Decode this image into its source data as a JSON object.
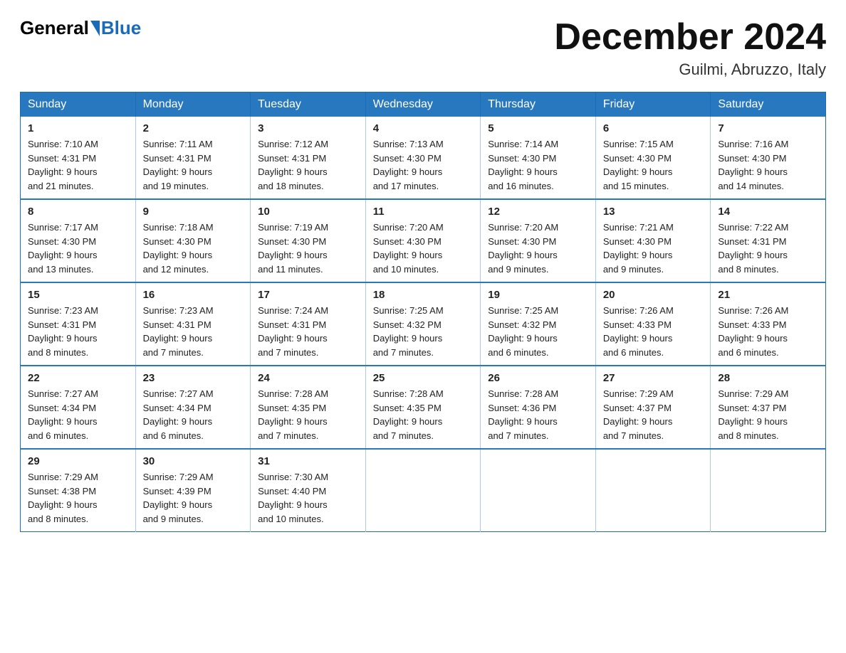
{
  "logo": {
    "general": "General",
    "blue": "Blue"
  },
  "title": "December 2024",
  "subtitle": "Guilmi, Abruzzo, Italy",
  "header_days": [
    "Sunday",
    "Monday",
    "Tuesday",
    "Wednesday",
    "Thursday",
    "Friday",
    "Saturday"
  ],
  "weeks": [
    [
      {
        "day": "1",
        "sunrise": "7:10 AM",
        "sunset": "4:31 PM",
        "daylight": "9 hours and 21 minutes."
      },
      {
        "day": "2",
        "sunrise": "7:11 AM",
        "sunset": "4:31 PM",
        "daylight": "9 hours and 19 minutes."
      },
      {
        "day": "3",
        "sunrise": "7:12 AM",
        "sunset": "4:31 PM",
        "daylight": "9 hours and 18 minutes."
      },
      {
        "day": "4",
        "sunrise": "7:13 AM",
        "sunset": "4:30 PM",
        "daylight": "9 hours and 17 minutes."
      },
      {
        "day": "5",
        "sunrise": "7:14 AM",
        "sunset": "4:30 PM",
        "daylight": "9 hours and 16 minutes."
      },
      {
        "day": "6",
        "sunrise": "7:15 AM",
        "sunset": "4:30 PM",
        "daylight": "9 hours and 15 minutes."
      },
      {
        "day": "7",
        "sunrise": "7:16 AM",
        "sunset": "4:30 PM",
        "daylight": "9 hours and 14 minutes."
      }
    ],
    [
      {
        "day": "8",
        "sunrise": "7:17 AM",
        "sunset": "4:30 PM",
        "daylight": "9 hours and 13 minutes."
      },
      {
        "day": "9",
        "sunrise": "7:18 AM",
        "sunset": "4:30 PM",
        "daylight": "9 hours and 12 minutes."
      },
      {
        "day": "10",
        "sunrise": "7:19 AM",
        "sunset": "4:30 PM",
        "daylight": "9 hours and 11 minutes."
      },
      {
        "day": "11",
        "sunrise": "7:20 AM",
        "sunset": "4:30 PM",
        "daylight": "9 hours and 10 minutes."
      },
      {
        "day": "12",
        "sunrise": "7:20 AM",
        "sunset": "4:30 PM",
        "daylight": "9 hours and 9 minutes."
      },
      {
        "day": "13",
        "sunrise": "7:21 AM",
        "sunset": "4:30 PM",
        "daylight": "9 hours and 9 minutes."
      },
      {
        "day": "14",
        "sunrise": "7:22 AM",
        "sunset": "4:31 PM",
        "daylight": "9 hours and 8 minutes."
      }
    ],
    [
      {
        "day": "15",
        "sunrise": "7:23 AM",
        "sunset": "4:31 PM",
        "daylight": "9 hours and 8 minutes."
      },
      {
        "day": "16",
        "sunrise": "7:23 AM",
        "sunset": "4:31 PM",
        "daylight": "9 hours and 7 minutes."
      },
      {
        "day": "17",
        "sunrise": "7:24 AM",
        "sunset": "4:31 PM",
        "daylight": "9 hours and 7 minutes."
      },
      {
        "day": "18",
        "sunrise": "7:25 AM",
        "sunset": "4:32 PM",
        "daylight": "9 hours and 7 minutes."
      },
      {
        "day": "19",
        "sunrise": "7:25 AM",
        "sunset": "4:32 PM",
        "daylight": "9 hours and 6 minutes."
      },
      {
        "day": "20",
        "sunrise": "7:26 AM",
        "sunset": "4:33 PM",
        "daylight": "9 hours and 6 minutes."
      },
      {
        "day": "21",
        "sunrise": "7:26 AM",
        "sunset": "4:33 PM",
        "daylight": "9 hours and 6 minutes."
      }
    ],
    [
      {
        "day": "22",
        "sunrise": "7:27 AM",
        "sunset": "4:34 PM",
        "daylight": "9 hours and 6 minutes."
      },
      {
        "day": "23",
        "sunrise": "7:27 AM",
        "sunset": "4:34 PM",
        "daylight": "9 hours and 6 minutes."
      },
      {
        "day": "24",
        "sunrise": "7:28 AM",
        "sunset": "4:35 PM",
        "daylight": "9 hours and 7 minutes."
      },
      {
        "day": "25",
        "sunrise": "7:28 AM",
        "sunset": "4:35 PM",
        "daylight": "9 hours and 7 minutes."
      },
      {
        "day": "26",
        "sunrise": "7:28 AM",
        "sunset": "4:36 PM",
        "daylight": "9 hours and 7 minutes."
      },
      {
        "day": "27",
        "sunrise": "7:29 AM",
        "sunset": "4:37 PM",
        "daylight": "9 hours and 7 minutes."
      },
      {
        "day": "28",
        "sunrise": "7:29 AM",
        "sunset": "4:37 PM",
        "daylight": "9 hours and 8 minutes."
      }
    ],
    [
      {
        "day": "29",
        "sunrise": "7:29 AM",
        "sunset": "4:38 PM",
        "daylight": "9 hours and 8 minutes."
      },
      {
        "day": "30",
        "sunrise": "7:29 AM",
        "sunset": "4:39 PM",
        "daylight": "9 hours and 9 minutes."
      },
      {
        "day": "31",
        "sunrise": "7:30 AM",
        "sunset": "4:40 PM",
        "daylight": "9 hours and 10 minutes."
      },
      null,
      null,
      null,
      null
    ]
  ],
  "labels": {
    "sunrise": "Sunrise:",
    "sunset": "Sunset:",
    "daylight": "Daylight:"
  }
}
